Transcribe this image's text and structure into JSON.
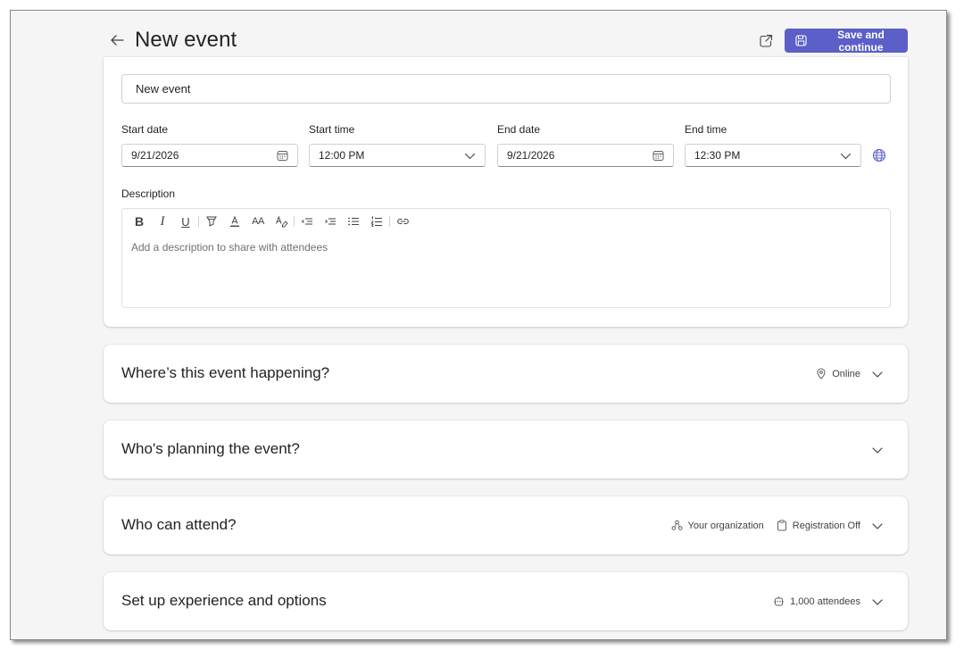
{
  "header": {
    "title": "New event",
    "save_label": "Save and continue"
  },
  "event": {
    "title_value": "New event",
    "start_date_label": "Start date",
    "start_date_value": "9/21/2026",
    "start_time_label": "Start time",
    "start_time_value": "12:00 PM",
    "end_date_label": "End date",
    "end_date_value": "9/21/2026",
    "end_time_label": "End time",
    "end_time_value": "12:30 PM",
    "description_label": "Description",
    "description_placeholder": "Add a description to share with attendees"
  },
  "toolbar": {
    "bold": "B",
    "italic": "I",
    "underline": "U",
    "font_size": "AA"
  },
  "sections": {
    "location": {
      "title": "Where’s this event happening?",
      "meta": "Online"
    },
    "planning": {
      "title": "Who's planning the event?"
    },
    "attend": {
      "title": "Who can attend?",
      "meta_audience": "Your organization",
      "meta_registration": "Registration Off"
    },
    "options": {
      "title": "Set up experience and options",
      "meta": "1,000 attendees"
    }
  },
  "colors": {
    "accent": "#5b5fc7",
    "page_bg": "#f5f5f5"
  },
  "icons": [
    "back-arrow-icon",
    "popout-icon",
    "save-icon",
    "calendar-icon",
    "chevron-down-icon",
    "globe-icon",
    "location-icon",
    "people-icon",
    "clipboard-icon",
    "options-icon"
  ]
}
